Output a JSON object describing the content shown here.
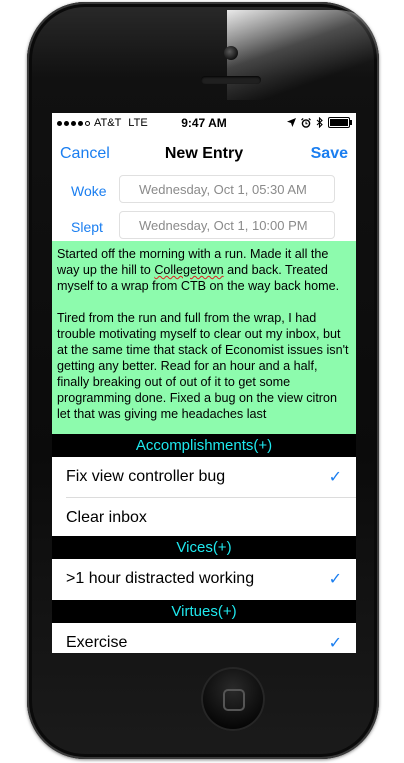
{
  "status_bar": {
    "carrier": "AT&T",
    "network": "LTE",
    "time": "9:47 AM"
  },
  "nav": {
    "cancel_label": "Cancel",
    "title": "New Entry",
    "save_label": "Save"
  },
  "woke": {
    "label": "Woke",
    "value": "Wednesday, Oct 1, 05:30 AM"
  },
  "slept": {
    "label": "Slept",
    "value": "Wednesday, Oct 1, 10:00 PM"
  },
  "notes": {
    "p1_before": "Started off the morning with a run. Made it all the way up the hill to ",
    "p1_misspelled": "Collegetown",
    "p1_after": " and back. Treated myself to a wrap from CTB on the way back home.",
    "p2": "Tired from the run and full from the wrap, I had trouble motivating myself to clear out my inbox, but at the same time that stack of Economist issues isn't getting any better.  Read for an hour and a half, finally breaking out of out of it to get some programming done. Fixed a bug on the view citron let that was giving me headaches last"
  },
  "sections": {
    "accomplishments": {
      "title": "Accomplishments(+)",
      "items": [
        {
          "label": "Fix view controller bug",
          "checked": true
        },
        {
          "label": "Clear inbox",
          "checked": false
        }
      ]
    },
    "vices": {
      "title": "Vices(+)",
      "items": [
        {
          "label": ">1 hour distracted working",
          "checked": true
        }
      ]
    },
    "virtues": {
      "title": "Virtues(+)",
      "items": [
        {
          "label": "Exercise",
          "checked": true
        }
      ]
    }
  },
  "icons": {
    "checkmark": "✓",
    "location": "location-arrow-icon",
    "alarm": "alarm-icon",
    "bluetooth": "bluetooth-icon"
  },
  "colors": {
    "accent": "#1a7ef0",
    "notes_background": "#8dfbad",
    "section_text": "#1fe8ee",
    "section_background": "#000000"
  }
}
